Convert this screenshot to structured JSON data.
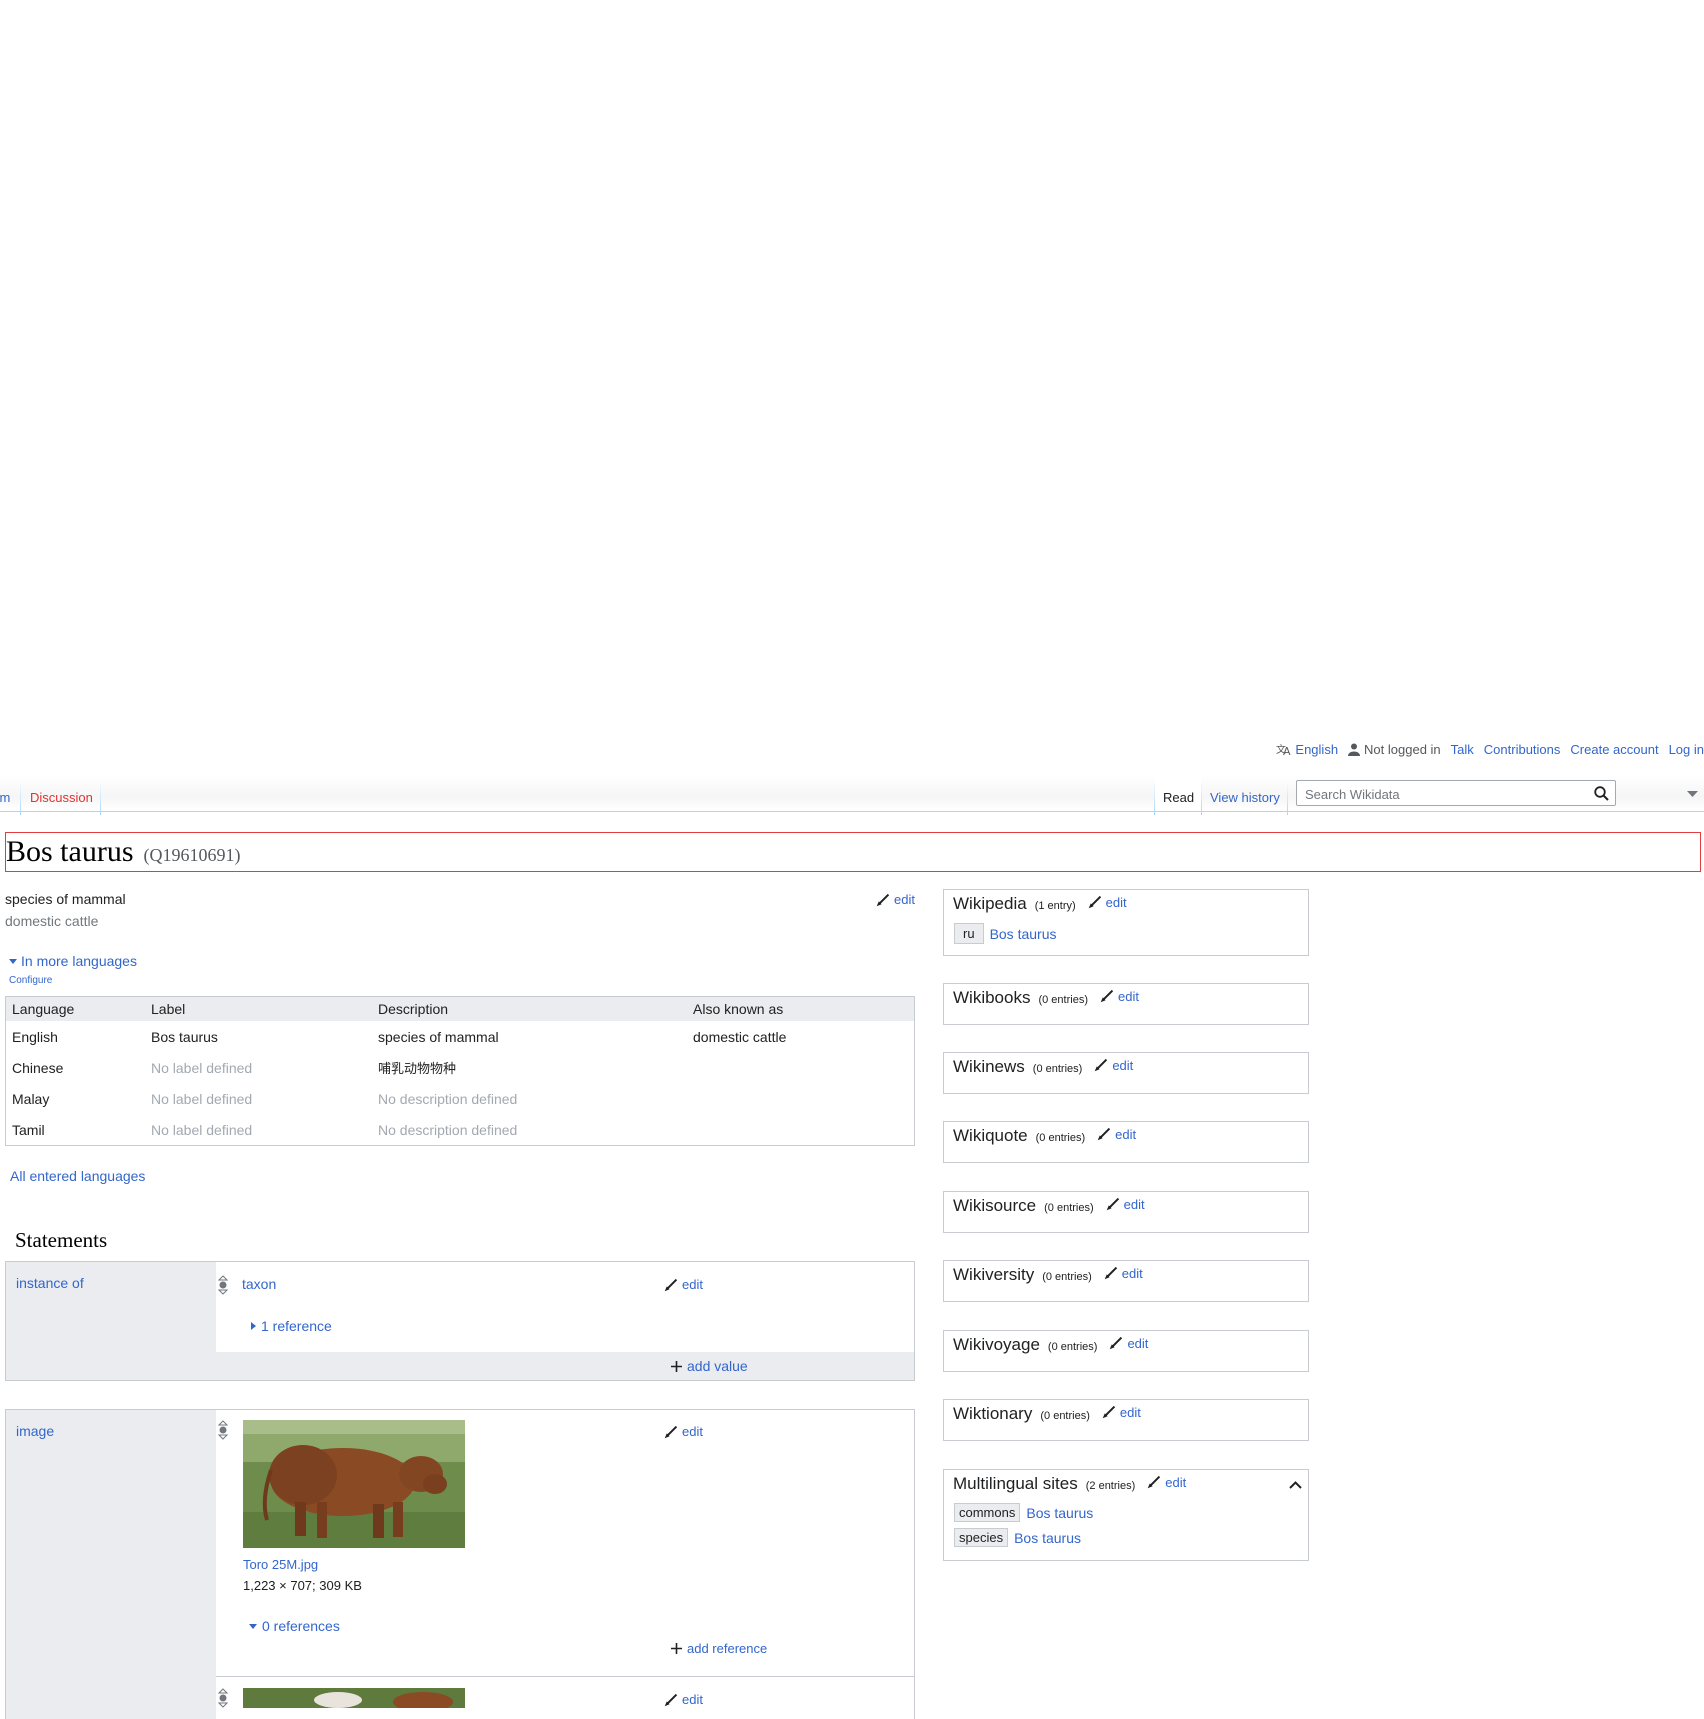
{
  "personal": {
    "language": "English",
    "status": "Not logged in",
    "talk": "Talk",
    "contributions": "Contributions",
    "create_account": "Create account",
    "login": "Log in"
  },
  "tabs": {
    "item": "Item",
    "discussion": "Discussion",
    "read": "Read",
    "view_history": "View history"
  },
  "search": {
    "placeholder": "Search Wikidata"
  },
  "title": {
    "label": "Bos taurus",
    "id": "(Q19610691)"
  },
  "entity": {
    "description": "species of mammal",
    "aliases": "domestic cattle",
    "edit": "edit"
  },
  "more_languages": {
    "toggle": "In more languages",
    "configure": "Configure",
    "all_entered": "All entered languages"
  },
  "lang_table": {
    "headers": [
      "Language",
      "Label",
      "Description",
      "Also known as"
    ],
    "rows": [
      {
        "language": "English",
        "label": "Bos taurus",
        "description": "species of mammal",
        "aliases": "domestic cattle"
      },
      {
        "language": "Chinese",
        "label": "No label defined",
        "description": "哺乳动物物种",
        "aliases": ""
      },
      {
        "language": "Malay",
        "label": "No label defined",
        "description": "No description defined",
        "aliases": ""
      },
      {
        "language": "Tamil",
        "label": "No label defined",
        "description": "No description defined",
        "aliases": ""
      }
    ]
  },
  "statements": {
    "heading": "Statements",
    "instance_of": {
      "property": "instance of",
      "value": "taxon",
      "references": "1 reference",
      "edit": "edit",
      "add_value": "add value"
    },
    "image": {
      "property": "image",
      "file": "Toro 25M.jpg",
      "meta": "1,223 × 707; 309 KB",
      "references": "0 references",
      "edit": "edit",
      "add_reference": "add reference",
      "edit2": "edit"
    }
  },
  "sitelinks": {
    "edit": "edit",
    "groups": [
      {
        "name": "Wikipedia",
        "count": "(1 entry)"
      },
      {
        "name": "Wikibooks",
        "count": "(0 entries)"
      },
      {
        "name": "Wikinews",
        "count": "(0 entries)"
      },
      {
        "name": "Wikiquote",
        "count": "(0 entries)"
      },
      {
        "name": "Wikisource",
        "count": "(0 entries)"
      },
      {
        "name": "Wikiversity",
        "count": "(0 entries)"
      },
      {
        "name": "Wikivoyage",
        "count": "(0 entries)"
      },
      {
        "name": "Wiktionary",
        "count": "(0 entries)"
      },
      {
        "name": "Multilingual sites",
        "count": "(2 entries)"
      }
    ],
    "wikipedia_links": [
      {
        "code": "ru",
        "title": "Bos taurus"
      }
    ],
    "multilingual_links": [
      {
        "code": "commons",
        "title": "Bos taurus"
      },
      {
        "code": "species",
        "title": "Bos taurus"
      }
    ]
  },
  "colors": {
    "link": "#3366cc",
    "red_link": "#dd3333",
    "title_frame": "#e03e3e",
    "panel_bg": "#eaecf0"
  }
}
